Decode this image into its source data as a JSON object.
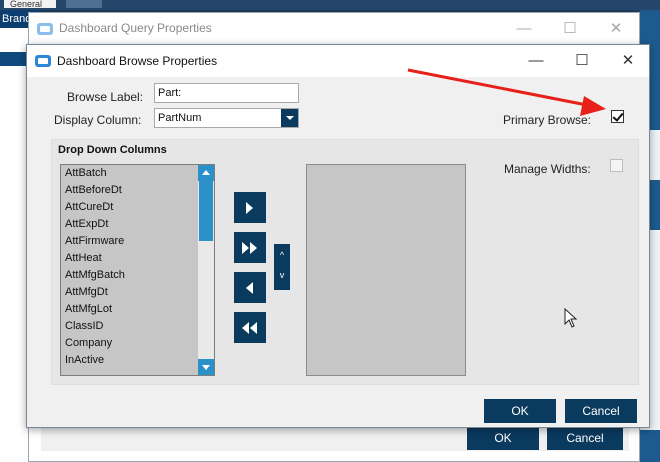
{
  "background": {
    "tabs": [
      "General"
    ],
    "left_header": "Brando"
  },
  "query_window": {
    "title": "Dashboard Query Properties",
    "buttons": {
      "ok": "OK",
      "cancel": "Cancel"
    }
  },
  "browse_dialog": {
    "title": "Dashboard Browse Properties",
    "caption": {
      "minimize": "—",
      "maximize": "☐",
      "close": "✕"
    },
    "browse_label": {
      "label": "Browse Label:",
      "value": "Part:"
    },
    "display_column": {
      "label": "Display Column:",
      "value": "PartNum"
    },
    "primary_browse": {
      "label": "Primary Browse:",
      "checked": true
    },
    "manage_widths": {
      "label": "Manage Widths:",
      "checked": false
    },
    "group_title": "Drop Down Columns",
    "available_columns": [
      "AttBatch",
      "AttBeforeDt",
      "AttCureDt",
      "AttExpDt",
      "AttFirmware",
      "AttHeat",
      "AttMfgBatch",
      "AttMfgDt",
      "AttMfgLot",
      "ClassID",
      "Company",
      "InActive"
    ],
    "order_buttons": {
      "up": "^",
      "down": "v"
    },
    "buttons": {
      "ok": "OK",
      "cancel": "Cancel"
    }
  },
  "colors": {
    "accent_dark": "#0b3a5f",
    "scrollbar_blue": "#2b8fc8",
    "annotation_red": "#e8201a"
  }
}
